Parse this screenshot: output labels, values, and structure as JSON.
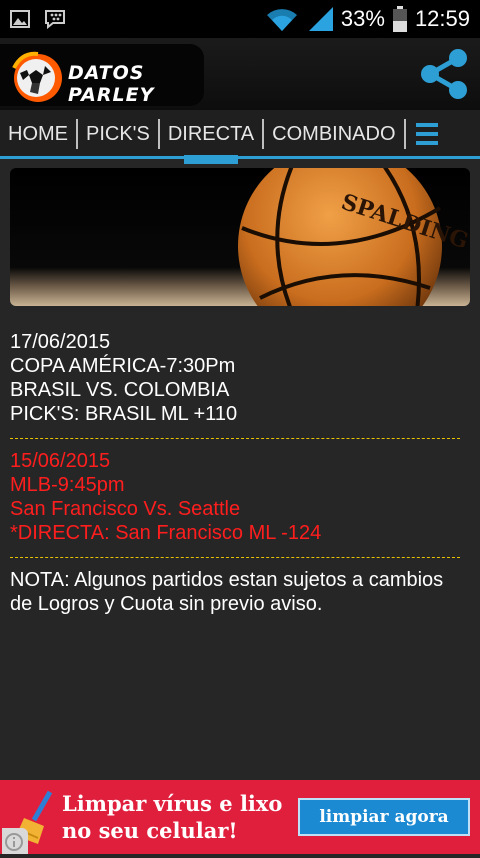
{
  "status_bar": {
    "battery_percent": "33%",
    "time": "12:59",
    "icons": [
      "image-icon",
      "bbm-icon",
      "wifi-icon",
      "signal-icon",
      "battery-icon"
    ]
  },
  "app": {
    "logo_text": "DATOS PARLEY",
    "share_icon": "share-icon"
  },
  "nav": {
    "items": [
      {
        "label": "HOME"
      },
      {
        "label": "PICK'S"
      },
      {
        "label": "DIRECTA"
      },
      {
        "label": "COMBINADO"
      }
    ],
    "active_index": 2,
    "menu_icon": "hamburger-menu-icon",
    "accent": "#2d9fd4"
  },
  "banner": {
    "image": "basketball-spalding-photo"
  },
  "entries": [
    {
      "date": "17/06/2015",
      "event": "COPA AMÉRICA-7:30Pm",
      "match": "BRASIL VS. COLOMBIA",
      "pick": "PICK'S: BRASIL ML +110",
      "color": "#ffffff"
    },
    {
      "date": "15/06/2015",
      "event": "MLB-9:45pm",
      "match": "San Francisco Vs. Seattle",
      "pick": "*DIRECTA: San Francisco ML -124",
      "color": "#ff1e1e"
    }
  ],
  "note": "NOTA: Algunos partidos estan sujetos a cambios de Logros y Cuota sin previo aviso.",
  "ad": {
    "line1": "Limpar vírus e lixo",
    "line2": "no seu celular!",
    "button": "limpiar agora",
    "background": "#e01f3d"
  }
}
